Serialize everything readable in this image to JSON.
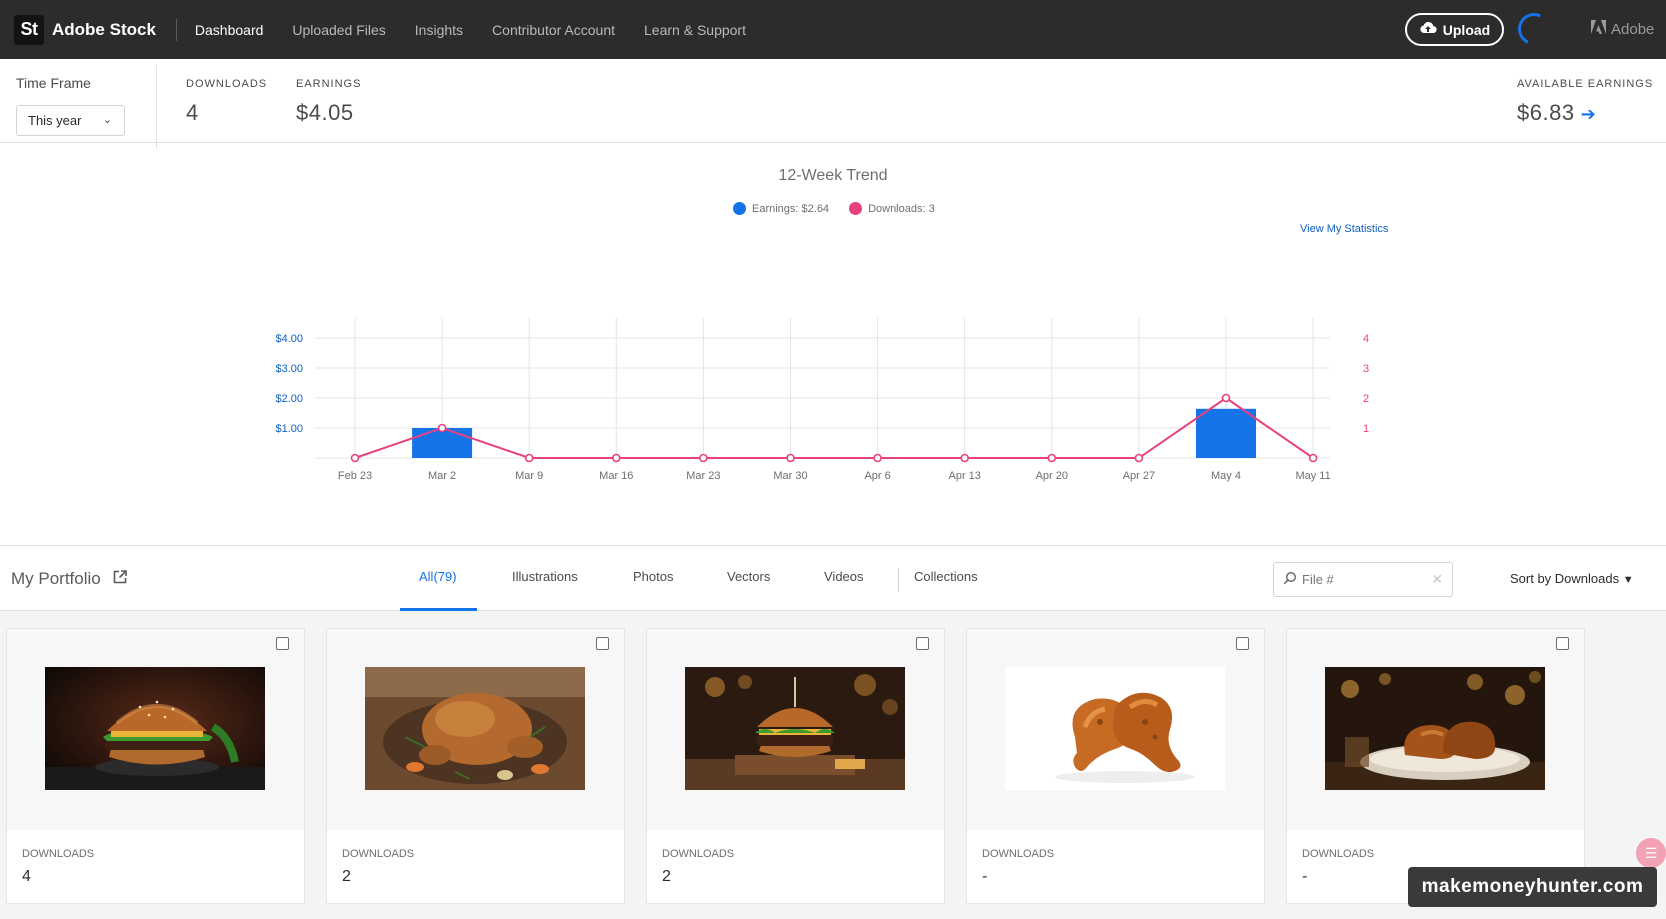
{
  "nav": {
    "logo": "St",
    "brand": "Adobe Stock",
    "items": [
      "Dashboard",
      "Uploaded Files",
      "Insights",
      "Contributor Account",
      "Learn & Support"
    ],
    "upload_label": "Upload",
    "adobe_label": "Adobe"
  },
  "timeframe": {
    "label": "Time Frame",
    "selected": "This year"
  },
  "stats": {
    "downloads_label": "DOWNLOADS",
    "downloads_value": "4",
    "earnings_label": "EARNINGS",
    "earnings_value": "$4.05",
    "available_label": "AVAILABLE EARNINGS",
    "available_value": "$6.83"
  },
  "trend": {
    "view_stats_label": "View My Statistics"
  },
  "chart_data": {
    "type": "bar",
    "title": "12-Week Trend",
    "categories": [
      "Feb 23",
      "Mar 2",
      "Mar 9",
      "Mar 16",
      "Mar 23",
      "Mar 30",
      "Apr 6",
      "Apr 13",
      "Apr 20",
      "Apr 27",
      "May 4",
      "May 11"
    ],
    "series": [
      {
        "name": "Earnings: $2.64",
        "type": "bar",
        "axis": "left",
        "color": "#1473e6",
        "values": [
          0,
          1.0,
          0,
          0,
          0,
          0,
          0,
          0,
          0,
          0,
          1.64,
          0
        ]
      },
      {
        "name": "Downloads: 3",
        "type": "line",
        "axis": "right",
        "color": "#e8417f",
        "values": [
          0,
          1,
          0,
          0,
          0,
          0,
          0,
          0,
          0,
          0,
          2,
          0
        ]
      }
    ],
    "y_left_ticks": [
      "$1.00",
      "$2.00",
      "$3.00",
      "$4.00"
    ],
    "y_left_lim": [
      0,
      4
    ],
    "y_right_ticks": [
      "1",
      "2",
      "3",
      "4"
    ],
    "y_right_lim": [
      0,
      4
    ],
    "grid": true,
    "legend": "top-center"
  },
  "portfolio": {
    "title": "My Portfolio",
    "tabs": [
      "All(79)",
      "Illustrations",
      "Photos",
      "Vectors",
      "Videos",
      "Collections"
    ],
    "search_placeholder": "File #",
    "sort_label": "Sort by Downloads",
    "cards": [
      {
        "downloads_label": "DOWNLOADS",
        "downloads": "4",
        "subject": "burger"
      },
      {
        "downloads_label": "DOWNLOADS",
        "downloads": "2",
        "subject": "roast chicken"
      },
      {
        "downloads_label": "DOWNLOADS",
        "downloads": "2",
        "subject": "burger"
      },
      {
        "downloads_label": "DOWNLOADS",
        "downloads": "-",
        "subject": "fried chicken"
      },
      {
        "downloads_label": "DOWNLOADS",
        "downloads": "-",
        "subject": "fried chicken"
      }
    ]
  },
  "watermark": "makemoneyhunter.com",
  "colors": {
    "accent": "#1473e6",
    "downloads_line": "#e8417f",
    "topbar": "#2c2c2c"
  }
}
